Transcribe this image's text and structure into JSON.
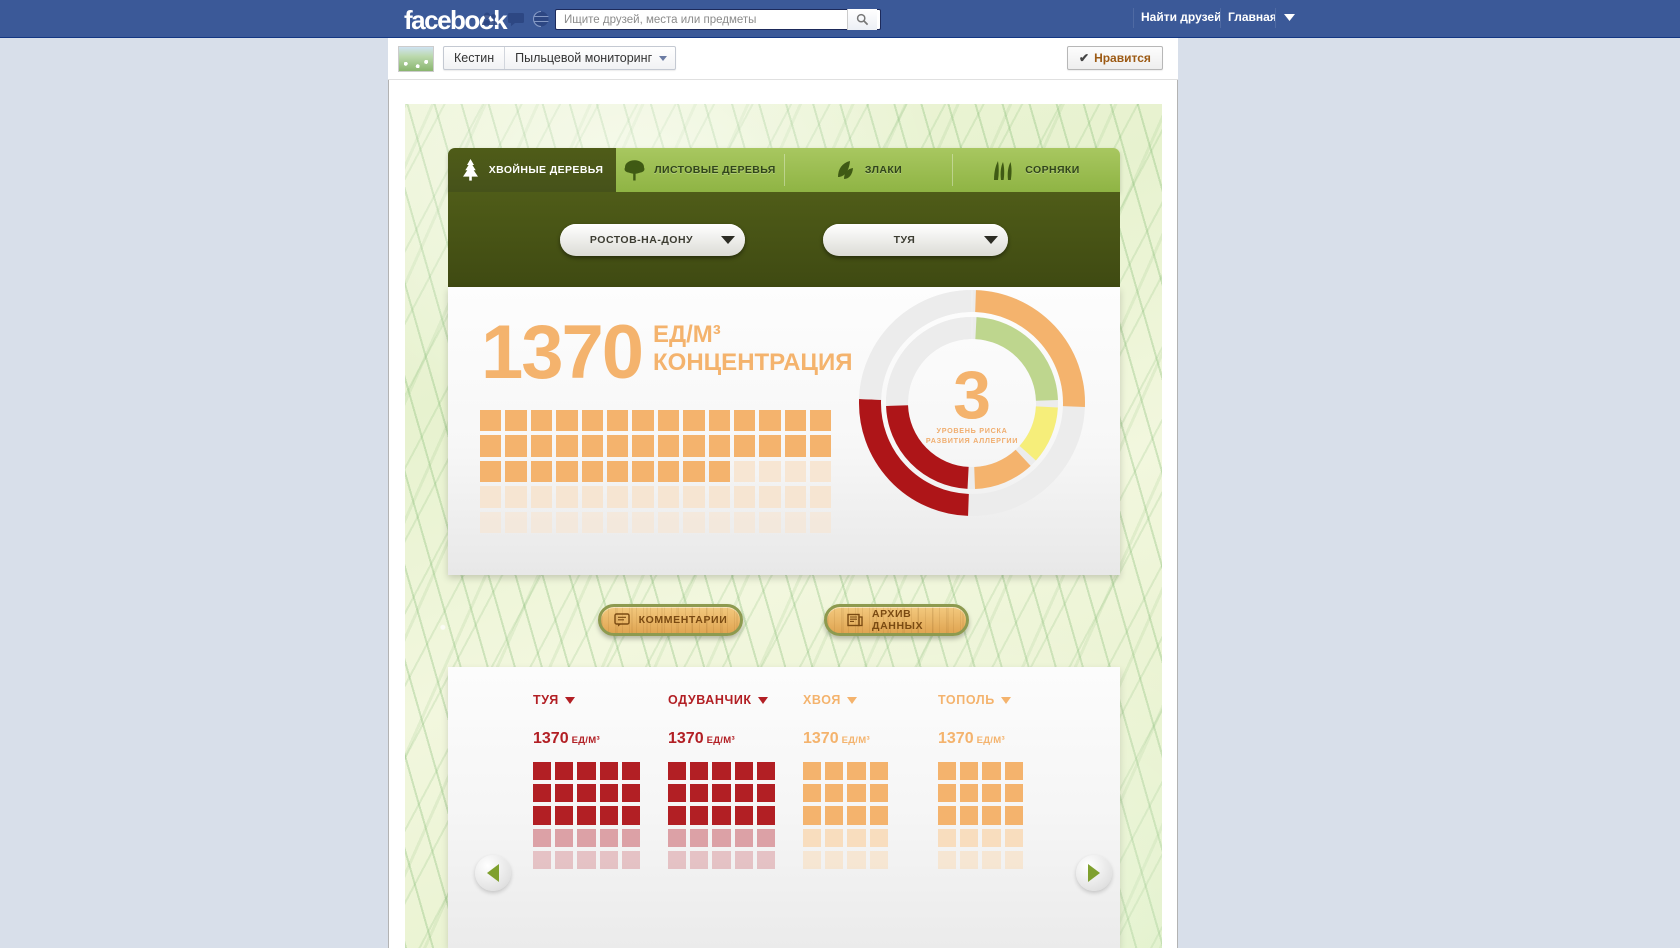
{
  "facebook": {
    "logo": "facebook",
    "icons": [
      "friend-requests-icon",
      "messages-icon",
      "notifications-icon"
    ],
    "search": {
      "placeholder": "Ищите друзей, места или предметы",
      "value": "",
      "button_icon": "search-icon"
    },
    "find_friends": "Найти друзей",
    "home": "Главная",
    "account_caret": "chevron-down-icon"
  },
  "page_header": {
    "avatar": "page-avatar",
    "user_name": "Кестин",
    "page_name": "Пыльцевой мониторинг",
    "like_button": "Нравится",
    "like_check": "✔"
  },
  "tabs": [
    {
      "label": "ХВОЙНЫЕ ДЕРЕВЬЯ",
      "icon": "conifer-tree-icon",
      "active": true
    },
    {
      "label": "ЛИСТОВЫЕ ДЕРЕВЬЯ",
      "icon": "broadleaf-tree-icon",
      "active": false
    },
    {
      "label": "ЗЛАКИ",
      "icon": "grain-leaf-icon",
      "active": false
    },
    {
      "label": "СОРНЯКИ",
      "icon": "weed-grass-icon",
      "active": false
    }
  ],
  "controls": {
    "city": {
      "value": "РОСТОВ-НА-ДОНУ",
      "caret": "chevron-down-icon"
    },
    "plant": {
      "value": "ТУЯ",
      "caret": "chevron-down-icon"
    }
  },
  "main_card": {
    "concentration_value": "1370",
    "unit": "ЕД/М³",
    "concentration_label": "КОНЦЕНТРАЦИЯ",
    "risk_number": "3",
    "risk_caption_line1": "УРОВЕНЬ РИСКА",
    "risk_caption_line2": "РАЗВИТИЯ АЛЛЕРГИИ",
    "grid": {
      "columns": 14,
      "rows": 5,
      "filled": 38,
      "fill_color": "#f4b36d",
      "empty_color": "#f7e3cd"
    },
    "donut": {
      "outer": [
        {
          "name": "red-outer",
          "color": "#ae1518",
          "start": -90,
          "end": -207
        },
        {
          "name": "orange-outer",
          "color": "#f4b36d",
          "start": 27,
          "end": 91
        },
        {
          "name": "gap-outer",
          "color": "#ececec",
          "start": 91,
          "end": 153
        }
      ],
      "inner": [
        {
          "name": "green-inner",
          "color": "#bed68e",
          "start": -90,
          "end": -27
        },
        {
          "name": "yellow-inner",
          "color": "#f6ee7a",
          "start": 63,
          "end": 90
        },
        {
          "name": "orange-inner",
          "color": "#f4b36d",
          "start": 90,
          "end": 180
        },
        {
          "name": "red-inner",
          "color": "#ae1518",
          "start": 180,
          "end": 270
        }
      ]
    }
  },
  "actions": {
    "comments": {
      "label": "КОММЕНТАРИИ",
      "icon": "comment-bubble-icon"
    },
    "archive": {
      "label": "АРХИВ ДАННЫХ",
      "icon": "archive-newspaper-icon"
    }
  },
  "bottom_panel": {
    "prev_icon": "arrow-left-icon",
    "next_icon": "arrow-right-icon",
    "unit": "ЕД/М³",
    "plants": [
      {
        "name": "ТУЯ",
        "value": "1370",
        "color": "#b21f24",
        "light": "#dca1a6",
        "columns": 5,
        "rows": 5,
        "filled": 15
      },
      {
        "name": "ОДУВАНЧИК",
        "value": "1370",
        "color": "#b21f24",
        "light": "#dca1a6",
        "columns": 5,
        "rows": 5,
        "filled": 15
      },
      {
        "name": "ХВОЯ",
        "value": "1370",
        "color": "#f4b36d",
        "light": "#f8ddbe",
        "columns": 4,
        "rows": 5,
        "filled": 12
      },
      {
        "name": "ТОПОЛЬ",
        "value": "1370",
        "color": "#f4b36d",
        "light": "#f8ddbe",
        "columns": 4,
        "rows": 5,
        "filled": 12
      }
    ]
  },
  "colors": {
    "fb_blue": "#3b5998",
    "accent_orange": "#f4b36d",
    "accent_red": "#b21f24",
    "dark_olive": "#4f5c18",
    "light_green": "#a8c760"
  }
}
